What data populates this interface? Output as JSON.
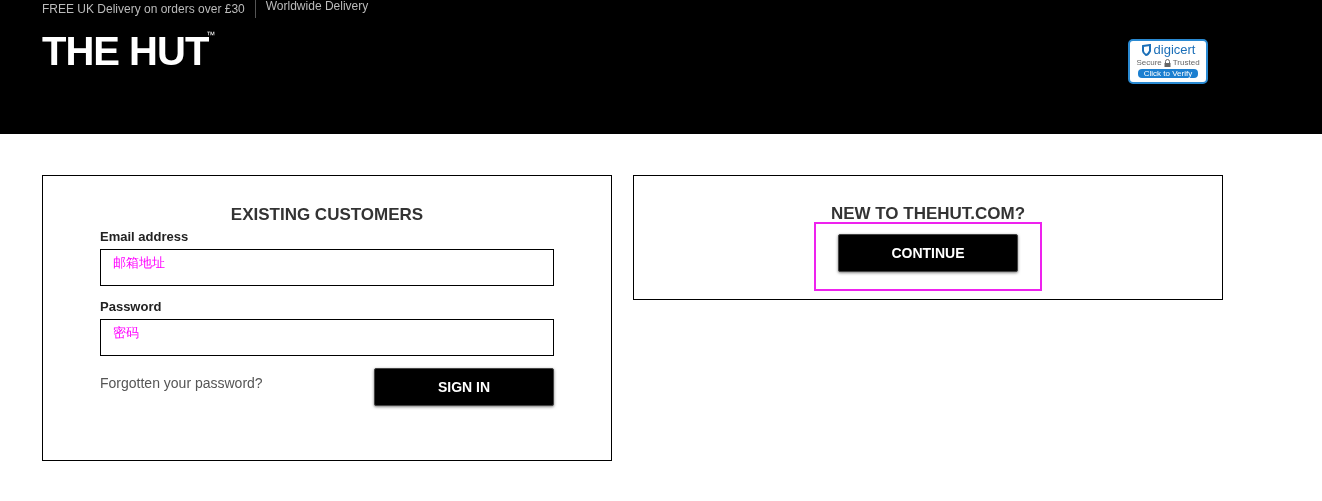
{
  "top_bar": {
    "items": [
      "FREE UK Delivery on orders over £30",
      "Worldwide Delivery"
    ]
  },
  "logo": {
    "text": "THE HUT",
    "mark": "™"
  },
  "trust_badge": {
    "brand": "digicert",
    "line_left": "Secure",
    "line_right": "Trusted",
    "button": "Click to Verify"
  },
  "existing_customers": {
    "title": "EXISTING CUSTOMERS",
    "fields": [
      {
        "label": "Email address",
        "annotation": "邮箱地址"
      },
      {
        "label": "Password",
        "annotation": "密码"
      }
    ],
    "forgot_link": "Forgotten your password?",
    "button": "SIGN IN"
  },
  "new_customers": {
    "title": "NEW TO THEHUT.COM?",
    "button": "CONTINUE",
    "highlighted": true
  }
}
